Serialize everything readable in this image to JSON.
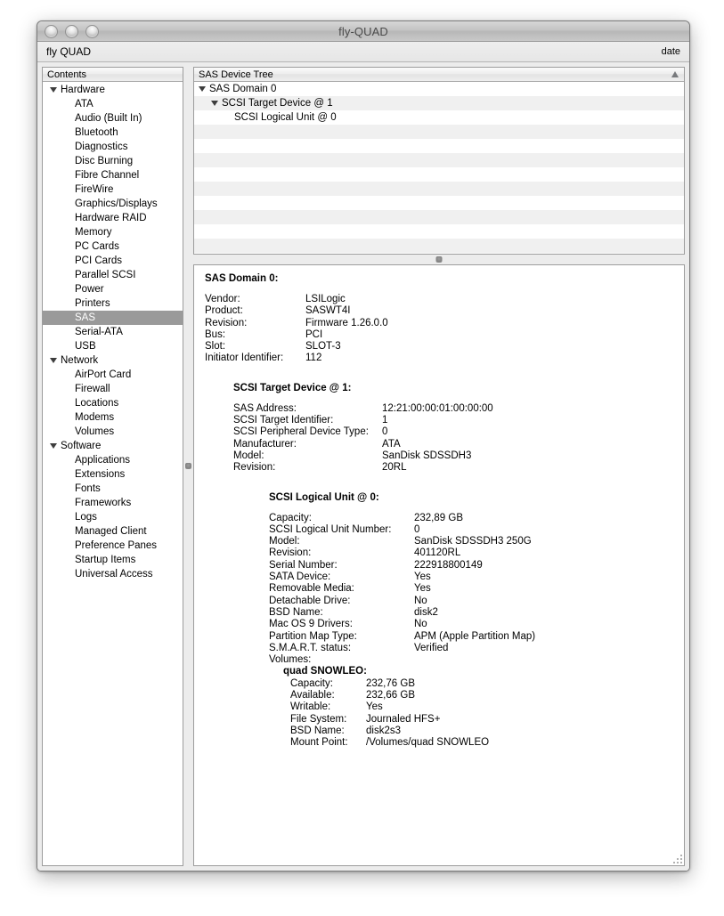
{
  "window": {
    "title": "fly-QUAD",
    "traffic_lights": [
      "close-button",
      "minimize-button",
      "zoom-button"
    ]
  },
  "toolbar": {
    "left_label": "fly QUAD",
    "right_label": "date"
  },
  "sidebar": {
    "header": "Contents",
    "items": [
      {
        "label": "Hardware",
        "type": "group",
        "selected": false
      },
      {
        "label": "ATA",
        "type": "child",
        "selected": false
      },
      {
        "label": "Audio (Built In)",
        "type": "child",
        "selected": false
      },
      {
        "label": "Bluetooth",
        "type": "child",
        "selected": false
      },
      {
        "label": "Diagnostics",
        "type": "child",
        "selected": false
      },
      {
        "label": "Disc Burning",
        "type": "child",
        "selected": false
      },
      {
        "label": "Fibre Channel",
        "type": "child",
        "selected": false
      },
      {
        "label": "FireWire",
        "type": "child",
        "selected": false
      },
      {
        "label": "Graphics/Displays",
        "type": "child",
        "selected": false
      },
      {
        "label": "Hardware RAID",
        "type": "child",
        "selected": false
      },
      {
        "label": "Memory",
        "type": "child",
        "selected": false
      },
      {
        "label": "PC Cards",
        "type": "child",
        "selected": false
      },
      {
        "label": "PCI Cards",
        "type": "child",
        "selected": false
      },
      {
        "label": "Parallel SCSI",
        "type": "child",
        "selected": false
      },
      {
        "label": "Power",
        "type": "child",
        "selected": false
      },
      {
        "label": "Printers",
        "type": "child",
        "selected": false
      },
      {
        "label": "SAS",
        "type": "child",
        "selected": true
      },
      {
        "label": "Serial-ATA",
        "type": "child",
        "selected": false
      },
      {
        "label": "USB",
        "type": "child",
        "selected": false
      },
      {
        "label": "Network",
        "type": "group",
        "selected": false
      },
      {
        "label": "AirPort Card",
        "type": "child",
        "selected": false
      },
      {
        "label": "Firewall",
        "type": "child",
        "selected": false
      },
      {
        "label": "Locations",
        "type": "child",
        "selected": false
      },
      {
        "label": "Modems",
        "type": "child",
        "selected": false
      },
      {
        "label": "Volumes",
        "type": "child",
        "selected": false
      },
      {
        "label": "Software",
        "type": "group",
        "selected": false
      },
      {
        "label": "Applications",
        "type": "child",
        "selected": false
      },
      {
        "label": "Extensions",
        "type": "child",
        "selected": false
      },
      {
        "label": "Fonts",
        "type": "child",
        "selected": false
      },
      {
        "label": "Frameworks",
        "type": "child",
        "selected": false
      },
      {
        "label": "Logs",
        "type": "child",
        "selected": false
      },
      {
        "label": "Managed Client",
        "type": "child",
        "selected": false
      },
      {
        "label": "Preference Panes",
        "type": "child",
        "selected": false
      },
      {
        "label": "Startup Items",
        "type": "child",
        "selected": false
      },
      {
        "label": "Universal Access",
        "type": "child",
        "selected": false
      }
    ]
  },
  "tree": {
    "header": "SAS Device Tree",
    "sort_direction": "ascending",
    "rows": [
      {
        "label": "SAS Domain 0",
        "indent": 0,
        "disclosure": true
      },
      {
        "label": "SCSI Target Device @ 1",
        "indent": 1,
        "disclosure": true
      },
      {
        "label": "SCSI Logical Unit @ 0",
        "indent": 2,
        "disclosure": false
      },
      {
        "label": "",
        "indent": 0,
        "disclosure": false
      },
      {
        "label": "",
        "indent": 0,
        "disclosure": false
      },
      {
        "label": "",
        "indent": 0,
        "disclosure": false
      },
      {
        "label": "",
        "indent": 0,
        "disclosure": false
      },
      {
        "label": "",
        "indent": 0,
        "disclosure": false
      },
      {
        "label": "",
        "indent": 0,
        "disclosure": false
      },
      {
        "label": "",
        "indent": 0,
        "disclosure": false
      },
      {
        "label": "",
        "indent": 0,
        "disclosure": false
      },
      {
        "label": "",
        "indent": 0,
        "disclosure": false
      }
    ]
  },
  "detail": {
    "domain": {
      "title": "SAS Domain 0:",
      "rows": [
        {
          "key": "Vendor:",
          "value": "LSILogic"
        },
        {
          "key": "Product:",
          "value": "SASWT4I"
        },
        {
          "key": "Revision:",
          "value": "Firmware 1.26.0.0"
        },
        {
          "key": "Bus:",
          "value": "PCI"
        },
        {
          "key": "Slot:",
          "value": "SLOT-3"
        },
        {
          "key": "Initiator Identifier:",
          "value": "112"
        }
      ]
    },
    "target": {
      "title": "SCSI Target Device @ 1:",
      "rows": [
        {
          "key": "SAS Address:",
          "value": "12:21:00:00:01:00:00:00"
        },
        {
          "key": "SCSI Target Identifier:",
          "value": "1"
        },
        {
          "key": "SCSI Peripheral Device Type:",
          "value": "0"
        },
        {
          "key": "Manufacturer:",
          "value": "ATA"
        },
        {
          "key": "Model:",
          "value": "SanDisk SDSSDH3"
        },
        {
          "key": "Revision:",
          "value": "20RL"
        }
      ]
    },
    "lun": {
      "title": "SCSI Logical Unit @ 0:",
      "rows": [
        {
          "key": "Capacity:",
          "value": "232,89 GB"
        },
        {
          "key": "SCSI Logical Unit Number:",
          "value": "0"
        },
        {
          "key": "Model:",
          "value": "SanDisk SDSSDH3 250G"
        },
        {
          "key": "Revision:",
          "value": "401120RL"
        },
        {
          "key": "Serial Number:",
          "value": "222918800149"
        },
        {
          "key": "SATA Device:",
          "value": "Yes"
        },
        {
          "key": "Removable Media:",
          "value": "Yes"
        },
        {
          "key": "Detachable Drive:",
          "value": "No"
        },
        {
          "key": "BSD Name:",
          "value": "disk2"
        },
        {
          "key": "Mac OS 9 Drivers:",
          "value": "No"
        },
        {
          "key": "Partition Map Type:",
          "value": "APM (Apple Partition Map)"
        },
        {
          "key": "S.M.A.R.T. status:",
          "value": "Verified"
        },
        {
          "key": "Volumes:",
          "value": ""
        }
      ],
      "volume": {
        "name": "quad SNOWLEO:",
        "rows": [
          {
            "key": "Capacity:",
            "value": "232,76 GB"
          },
          {
            "key": "Available:",
            "value": "232,66 GB"
          },
          {
            "key": "Writable:",
            "value": "Yes"
          },
          {
            "key": "File System:",
            "value": "Journaled HFS+"
          },
          {
            "key": "BSD Name:",
            "value": "disk2s3"
          },
          {
            "key": "Mount Point:",
            "value": "/Volumes/quad SNOWLEO"
          }
        ]
      }
    }
  },
  "colors": {
    "selection": "#9a9a9a",
    "window_chrome": "#ececec",
    "stripe": "#f0f0f0"
  }
}
